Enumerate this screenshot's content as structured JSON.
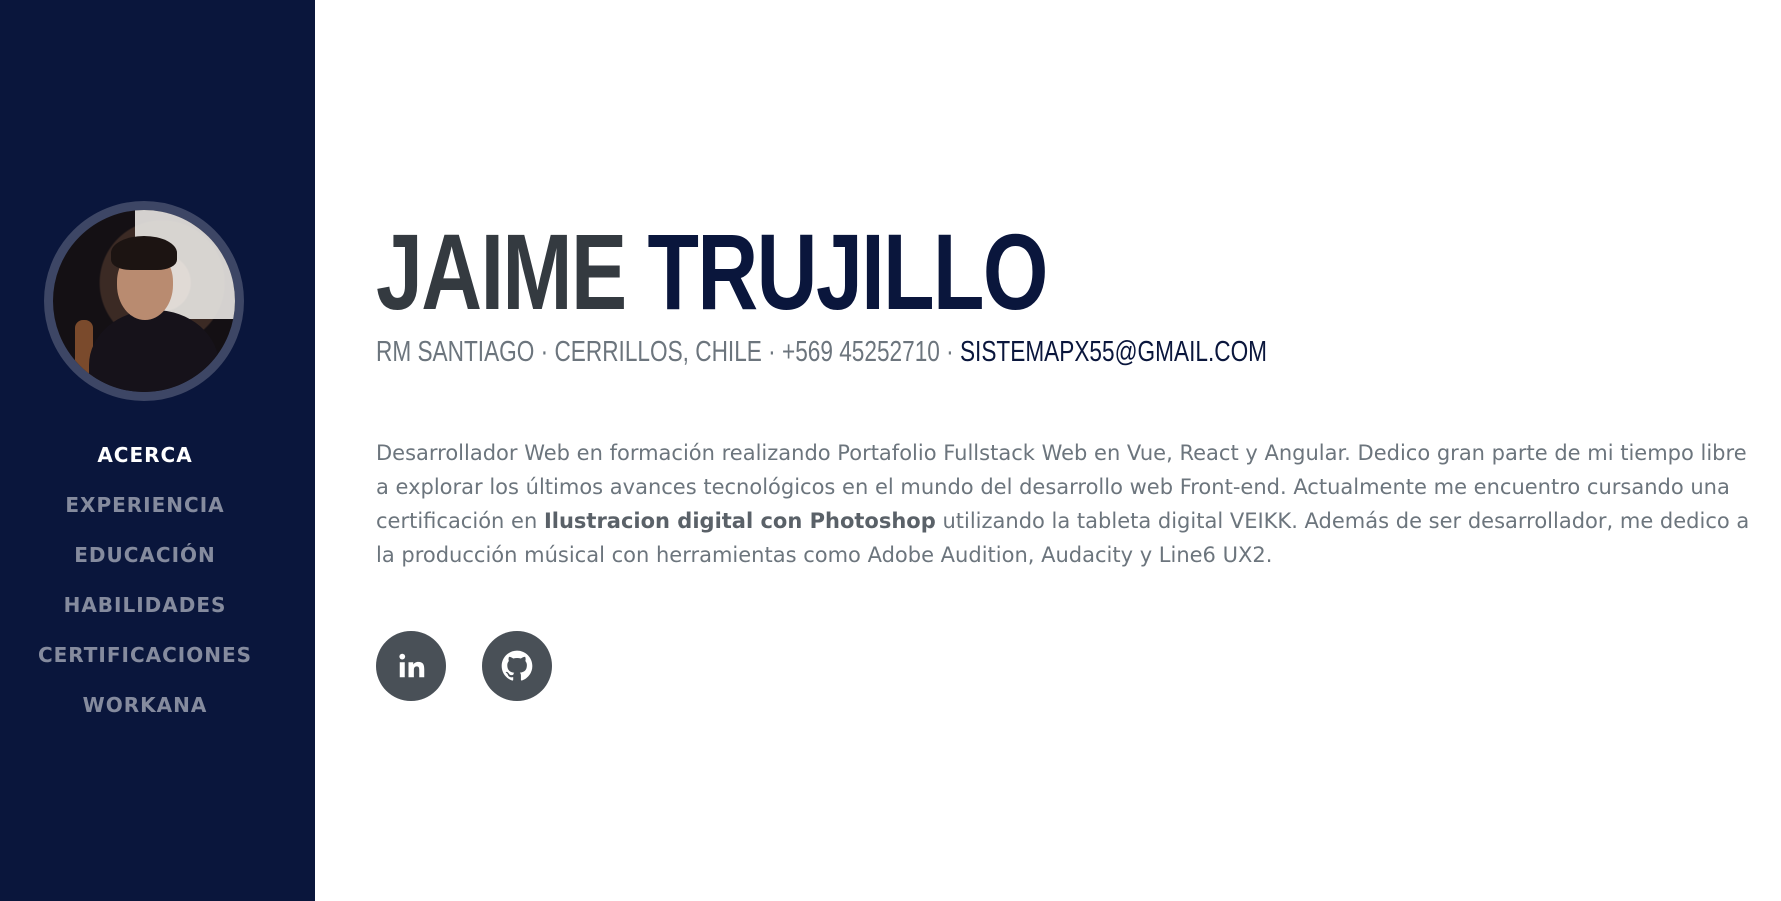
{
  "profile": {
    "first_name": "JAIME",
    "last_name": "TRUJILLO",
    "location": "RM SANTIAGO · CERRILLOS, CHILE",
    "separator": " · ",
    "phone": "+569 45252710",
    "email": "SISTEMAPX55@GMAIL.COM"
  },
  "sidebar": {
    "nav_items": [
      {
        "label": "ACERCA",
        "active": true
      },
      {
        "label": "EXPERIENCIA",
        "active": false
      },
      {
        "label": "EDUCACIÓN",
        "active": false
      },
      {
        "label": "HABILIDADES",
        "active": false
      },
      {
        "label": "CERTIFICACIONES",
        "active": false
      },
      {
        "label": "WORKANA",
        "active": false
      }
    ]
  },
  "about": {
    "text_before": "Desarrollador Web en formación realizando Portafolio Fullstack Web en Vue, React y Angular. Dedico gran parte de mi tiempo libre a explorar los últimos avances tecnológicos en el mundo del desarrollo web Front-end. Actualmente me encuentro cursando una certificación en ",
    "highlight": "Ilustracion digital con Photoshop",
    "text_after": " utilizando la tableta digital VEIKK. Además de ser desarrollador, me dedico a la producción músical con herramientas como Adobe Audition, Audacity y Line6 UX2."
  },
  "social": [
    {
      "icon": "linkedin-icon"
    },
    {
      "icon": "github-icon"
    }
  ],
  "colors": {
    "sidebar_bg": "#0a163c",
    "primary": "#0a163c",
    "text_dark": "#343a40",
    "text_muted": "#6c757d",
    "social_bg": "#495057"
  }
}
